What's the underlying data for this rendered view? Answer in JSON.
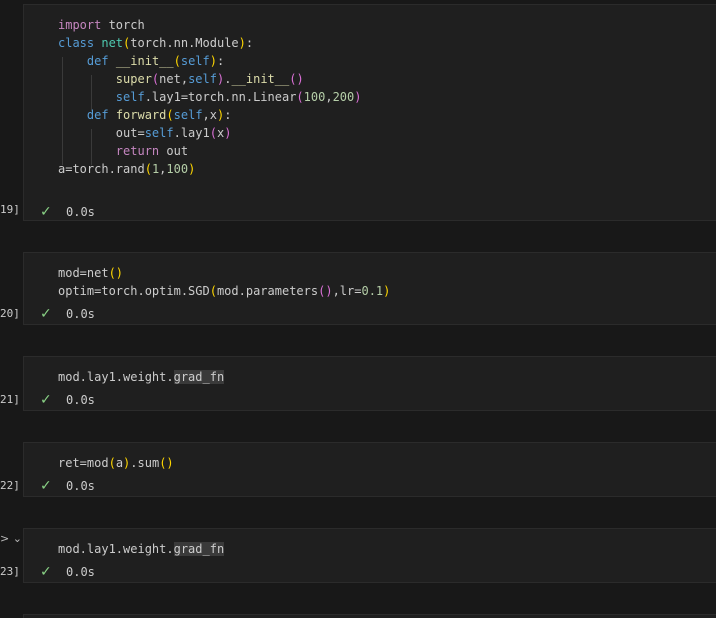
{
  "cells": [
    {
      "exec_label": "19]",
      "status_time": "0.0s",
      "code": [
        [
          [
            "kw",
            "import"
          ],
          [
            "var",
            " torch"
          ]
        ],
        [
          [
            "kw2",
            "class"
          ],
          [
            "var",
            " "
          ],
          [
            "cls",
            "net"
          ],
          [
            "p1",
            "("
          ],
          [
            "var",
            "torch.nn.Module"
          ],
          [
            "p1",
            ")"
          ],
          [
            "var",
            ":"
          ]
        ],
        [
          [
            "var",
            "    "
          ],
          [
            "kw2",
            "def"
          ],
          [
            "var",
            " "
          ],
          [
            "fn",
            "__init__"
          ],
          [
            "p1",
            "("
          ],
          [
            "self",
            "self"
          ],
          [
            "p1",
            ")"
          ],
          [
            "var",
            ":"
          ]
        ],
        [
          [
            "var",
            "        "
          ],
          [
            "fn",
            "super"
          ],
          [
            "p2",
            "("
          ],
          [
            "var",
            "net,"
          ],
          [
            "self",
            "self"
          ],
          [
            "p2",
            ")"
          ],
          [
            "var",
            "."
          ],
          [
            "fn",
            "__init__"
          ],
          [
            "p2",
            "()"
          ]
        ],
        [
          [
            "var",
            "        "
          ],
          [
            "self",
            "self"
          ],
          [
            "var",
            ".lay1=torch.nn.Linear"
          ],
          [
            "p2",
            "("
          ],
          [
            "num",
            "100"
          ],
          [
            "var",
            ","
          ],
          [
            "num",
            "200"
          ],
          [
            "p2",
            ")"
          ]
        ],
        [
          [
            "var",
            "    "
          ],
          [
            "kw2",
            "def"
          ],
          [
            "var",
            " "
          ],
          [
            "fn",
            "forward"
          ],
          [
            "p1",
            "("
          ],
          [
            "self",
            "self"
          ],
          [
            "var",
            ",x"
          ],
          [
            "p1",
            ")"
          ],
          [
            "var",
            ":"
          ]
        ],
        [
          [
            "var",
            "        out="
          ],
          [
            "self",
            "self"
          ],
          [
            "var",
            ".lay1"
          ],
          [
            "p2",
            "("
          ],
          [
            "var",
            "x"
          ],
          [
            "p2",
            ")"
          ]
        ],
        [
          [
            "var",
            "        "
          ],
          [
            "kw",
            "return"
          ],
          [
            "var",
            " out"
          ]
        ],
        [
          [
            "var",
            "a=torch.rand"
          ],
          [
            "p1",
            "("
          ],
          [
            "num",
            "1"
          ],
          [
            "var",
            ","
          ],
          [
            "num",
            "100"
          ],
          [
            "p1",
            ")"
          ]
        ]
      ]
    },
    {
      "exec_label": "20]",
      "status_time": "0.0s",
      "code": [
        [
          [
            "var",
            "mod=net"
          ],
          [
            "p1",
            "()"
          ]
        ],
        [
          [
            "var",
            "optim=torch.optim.SGD"
          ],
          [
            "p1",
            "("
          ],
          [
            "var",
            "mod.parameters"
          ],
          [
            "p2",
            "()"
          ],
          [
            "var",
            ",lr="
          ],
          [
            "num",
            "0.1"
          ],
          [
            "p1",
            ")"
          ]
        ]
      ]
    },
    {
      "exec_label": "21]",
      "status_time": "0.0s",
      "code": [
        [
          [
            "var",
            "mod.lay1.weight."
          ],
          [
            "hl",
            "grad_fn"
          ]
        ]
      ]
    },
    {
      "exec_label": "22]",
      "status_time": "0.0s",
      "code": [
        [
          [
            "var",
            "ret=mod"
          ],
          [
            "p1",
            "("
          ],
          [
            "var",
            "a"
          ],
          [
            "p1",
            ")"
          ],
          [
            "var",
            ".sum"
          ],
          [
            "p1",
            "()"
          ]
        ]
      ]
    },
    {
      "exec_label": "23]",
      "status_time": "0.0s",
      "code": [
        [
          [
            "var",
            "mod.lay1.weight."
          ],
          [
            "hl",
            "grad_fn"
          ]
        ]
      ]
    }
  ],
  "chevron_glyph": "> ⌄",
  "check_glyph": "✓"
}
